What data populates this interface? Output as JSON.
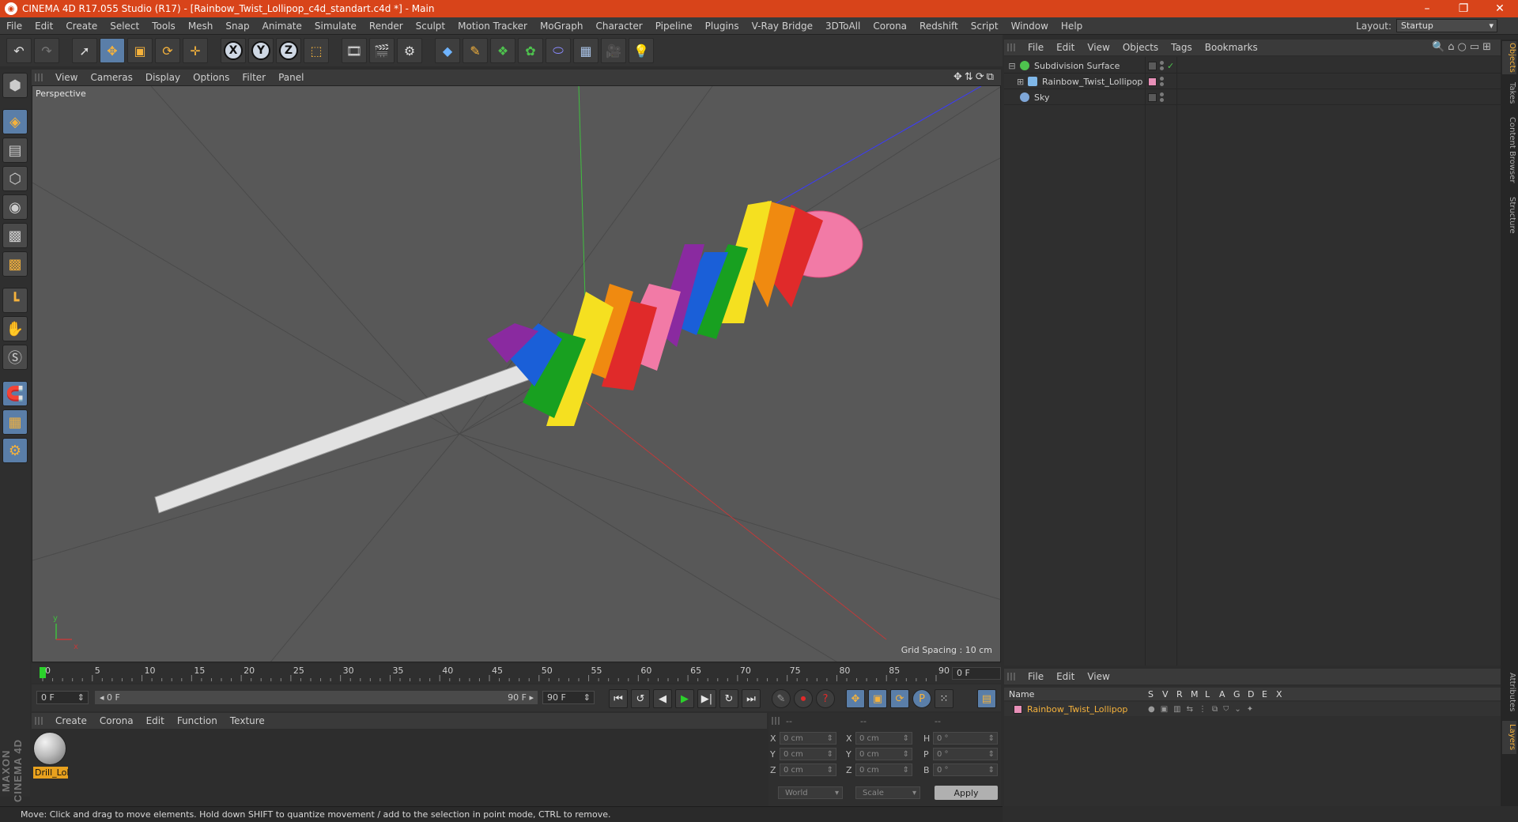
{
  "window": {
    "title": "CINEMA 4D R17.055 Studio (R17) - [Rainbow_Twist_Lollipop_c4d_standart.c4d *] - Main",
    "minimize": "–",
    "restore": "❐",
    "close": "✕"
  },
  "menubar": {
    "items": [
      "File",
      "Edit",
      "Create",
      "Select",
      "Tools",
      "Mesh",
      "Snap",
      "Animate",
      "Simulate",
      "Render",
      "Sculpt",
      "Motion Tracker",
      "MoGraph",
      "Character",
      "Pipeline",
      "Plugins",
      "V-Ray Bridge",
      "3DToAll",
      "Corona",
      "Redshift",
      "Script",
      "Window",
      "Help"
    ],
    "layout_label": "Layout:",
    "layout_value": "Startup"
  },
  "toolbar": {
    "undo_icon": "↶",
    "redo_icon": "↷",
    "select_icon": "➚",
    "move_icon": "✥",
    "scale_icon": "▣",
    "rotate_icon": "⟳",
    "transform_icon": "✛",
    "axis_x": "X",
    "axis_y": "Y",
    "axis_z": "Z",
    "coord_icon": "⬚",
    "render_view_icon": "🎞",
    "render_pv_icon": "🎬",
    "render_settings_icon": "⚙",
    "cube_icon": "◆",
    "pen_icon": "✎",
    "subdiv_icon": "❖",
    "mograph_icon": "✿",
    "deformer_icon": "⬭",
    "floor_icon": "▦",
    "camera_icon": "🎥",
    "light_icon": "💡"
  },
  "lefttools": {
    "icons": [
      "⬢",
      "◈",
      "▤",
      "⬡",
      "◉",
      "▩",
      "┗",
      "✋",
      "Ⓢ",
      "🧲",
      "▦",
      "⚙"
    ]
  },
  "viewport": {
    "menu": [
      "View",
      "Cameras",
      "Display",
      "Options",
      "Filter",
      "Panel"
    ],
    "nav_icons": "✥⇅⟳⧉",
    "label": "Perspective",
    "grid_spacing": "Grid Spacing : 10 cm",
    "axis_y": "y",
    "axis_x": "x"
  },
  "timeline": {
    "ticks": [
      "0",
      "5",
      "10",
      "15",
      "20",
      "25",
      "30",
      "35",
      "40",
      "45",
      "50",
      "55",
      "60",
      "65",
      "70",
      "75",
      "80",
      "85",
      "90"
    ],
    "current_frame": "0 F",
    "start_frame": "0 F",
    "range_start": "◂ 0 F",
    "range_end": "90 F ▸",
    "end_frame": "90 F"
  },
  "transport": {
    "first_icon": "⏮",
    "prev_key_icon": "↺",
    "prev_icon": "◀",
    "play_icon": "▶",
    "next_icon": "▶|",
    "next_key_icon": "↻",
    "last_icon": "⏭",
    "rec_icon": "✎",
    "autokey_icon": "⏺",
    "help_icon": "?",
    "move_icon": "✥",
    "scale_icon": "▣",
    "rotate_icon": "⟳",
    "param_icon": "P",
    "grid_icon": "⁙",
    "timeline_icon": "▤"
  },
  "materials": {
    "menu": [
      "Create",
      "Corona",
      "Edit",
      "Function",
      "Texture"
    ],
    "items": [
      {
        "name": "Drill_Lol"
      }
    ]
  },
  "coordinates": {
    "header": [
      "--",
      "--",
      "--"
    ],
    "rows": [
      {
        "l1": "X",
        "v1": "0 cm",
        "l2": "X",
        "v2": "0 cm",
        "l3": "H",
        "v3": "0 °"
      },
      {
        "l1": "Y",
        "v1": "0 cm",
        "l2": "Y",
        "v2": "0 cm",
        "l3": "P",
        "v3": "0 °"
      },
      {
        "l1": "Z",
        "v1": "0 cm",
        "l2": "Z",
        "v2": "0 cm",
        "l3": "B",
        "v3": "0 °"
      }
    ],
    "mode": "World",
    "type": "Scale",
    "apply": "Apply"
  },
  "status": {
    "text": "Move: Click and drag to move elements. Hold down SHIFT to quantize movement / add to the selection in point mode, CTRL to remove."
  },
  "objects": {
    "menu": [
      "File",
      "Edit",
      "View",
      "Objects",
      "Tags",
      "Bookmarks"
    ],
    "icons": "🔍⌂○▭⊞",
    "items": [
      {
        "name": "Subdivision Surface",
        "color": "#4ec24e"
      },
      {
        "name": "Rainbow_Twist_Lollipop",
        "color": "#7fb7e8"
      },
      {
        "name": "Sky",
        "color": "#7fa7d8"
      }
    ],
    "check_icon": "✓"
  },
  "layers": {
    "menu": [
      "File",
      "Edit",
      "View"
    ],
    "columns": [
      "Name",
      "S",
      "V",
      "R",
      "M",
      "L",
      "A",
      "G",
      "D",
      "E",
      "X"
    ],
    "row_name": "Rainbow_Twist_Lollipop",
    "row_color": "#e890b8"
  },
  "sidetabs": [
    "Objects",
    "Takes",
    "Content Browser",
    "Structure",
    "Attributes",
    "Layers"
  ],
  "colors": {
    "titlebar": "#d8441a",
    "accent": "#5a7ea8",
    "highlight": "#f5b23c"
  }
}
